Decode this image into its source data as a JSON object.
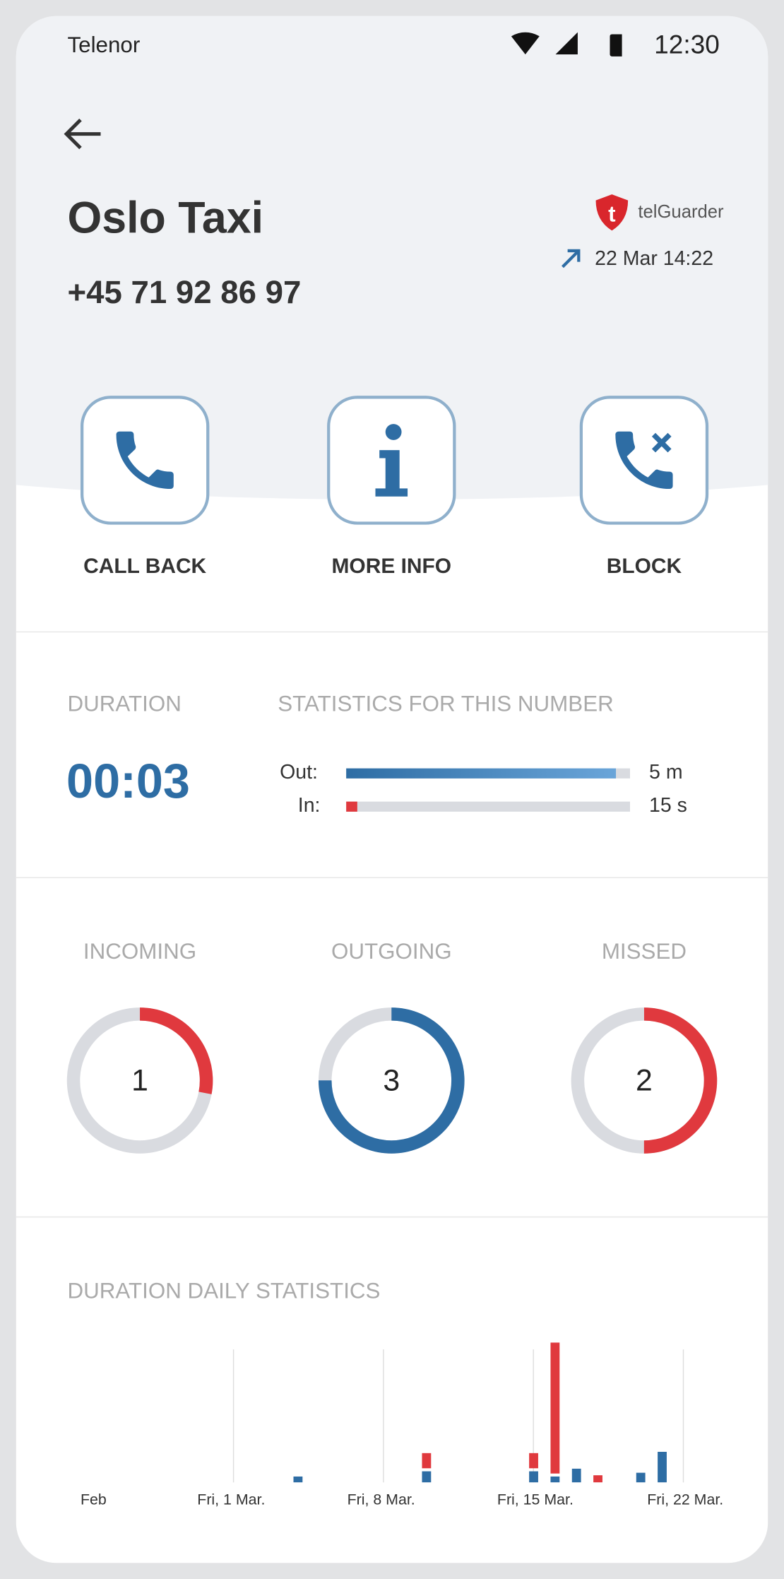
{
  "status_bar": {
    "carrier": "Telenor",
    "time": "12:30",
    "icons": [
      "wifi-icon",
      "signal-icon",
      "battery-icon"
    ]
  },
  "header": {
    "back_icon": "arrow-left-icon",
    "name": "Oslo Taxi",
    "number": "+45 71 92 86 97",
    "brand": "telGuarder",
    "call_direction_icon": "arrow-up-right-icon",
    "last_call": "22 Mar 14:22"
  },
  "actions": [
    {
      "label": "CALL BACK",
      "icon": "phone-icon"
    },
    {
      "label": "MORE INFO",
      "icon": "info-icon"
    },
    {
      "label": "BLOCK",
      "icon": "phone-block-icon"
    }
  ],
  "duration": {
    "title": "DURATION",
    "value": "00:03"
  },
  "statistics": {
    "title": "STATISTICS FOR THIS NUMBER",
    "out_label": "Out:",
    "out_value": "5 m",
    "out_fraction": 0.95,
    "in_label": "In:",
    "in_value": "15 s",
    "in_fraction": 0.04
  },
  "counts": [
    {
      "label": "INCOMING",
      "value": "1",
      "fraction": 0.28,
      "color": "#e0393e"
    },
    {
      "label": "OUTGOING",
      "value": "3",
      "fraction": 0.75,
      "color": "#2e6da4"
    },
    {
      "label": "MISSED",
      "value": "2",
      "fraction": 0.5,
      "color": "#e0393e"
    }
  ],
  "colors": {
    "accent": "#2e6da4",
    "red": "#e0393e",
    "border": "#8fb0cc"
  },
  "chart_title": "DURATION DAILY STATISTICS",
  "chart_data": {
    "type": "bar",
    "stacked": true,
    "x_tick_labels": [
      "Feb",
      "Fri, 1 Mar.",
      "Fri, 8 Mar.",
      "Fri, 15 Mar.",
      "Fri, 22 Mar."
    ],
    "grid": "vertical lines at weekly ticks",
    "days": [
      "4 Mar",
      "10 Mar",
      "15 Mar",
      "16 Mar",
      "17 Mar",
      "18 Mar",
      "20 Mar",
      "21 Mar"
    ],
    "series": [
      {
        "color": "#2e6da4",
        "values": [
          20,
          38,
          38,
          20,
          47,
          0,
          33,
          105
        ]
      },
      {
        "color": "#e0393e",
        "values": [
          0,
          60,
          60,
          518,
          0,
          28,
          0,
          0
        ]
      }
    ]
  }
}
